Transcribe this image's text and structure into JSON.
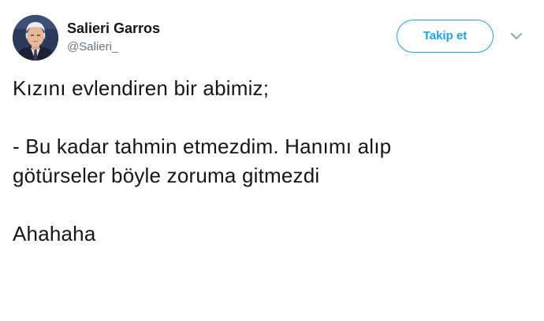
{
  "user": {
    "display_name": "Salieri Garros",
    "handle": "@Salieri_",
    "avatar_icon": "profile-photo"
  },
  "actions": {
    "follow_label": "Takip et",
    "more_icon": "chevron-down-icon"
  },
  "tweet": {
    "line1": "Kızını evlendiren bir abimiz;",
    "line2": "- Bu kadar tahmin etmezdim. Hanımı alıp",
    "line3": "götürseler böyle zoruma gitmezdi",
    "line4": "Ahahaha"
  },
  "colors": {
    "accent": "#1da1f2",
    "text": "#14171a",
    "secondary_text": "#657786"
  }
}
